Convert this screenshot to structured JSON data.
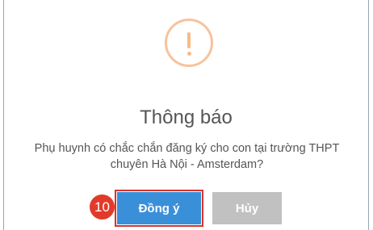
{
  "dialog": {
    "icon": "warning-exclamation-icon",
    "title": "Thông báo",
    "message": "Phụ huynh có chắc chắn đăng ký cho con tại trường THPT chuyên Hà Nội - Amsterdam?",
    "confirm_label": "Đồng ý",
    "cancel_label": "Hủy"
  },
  "annotation": {
    "step_number": "10"
  },
  "colors": {
    "icon": "#f8bb86",
    "confirm": "#3a8fd9",
    "cancel": "#c1c1c1",
    "highlight": "#d9332b",
    "badge": "#e23a2a"
  }
}
